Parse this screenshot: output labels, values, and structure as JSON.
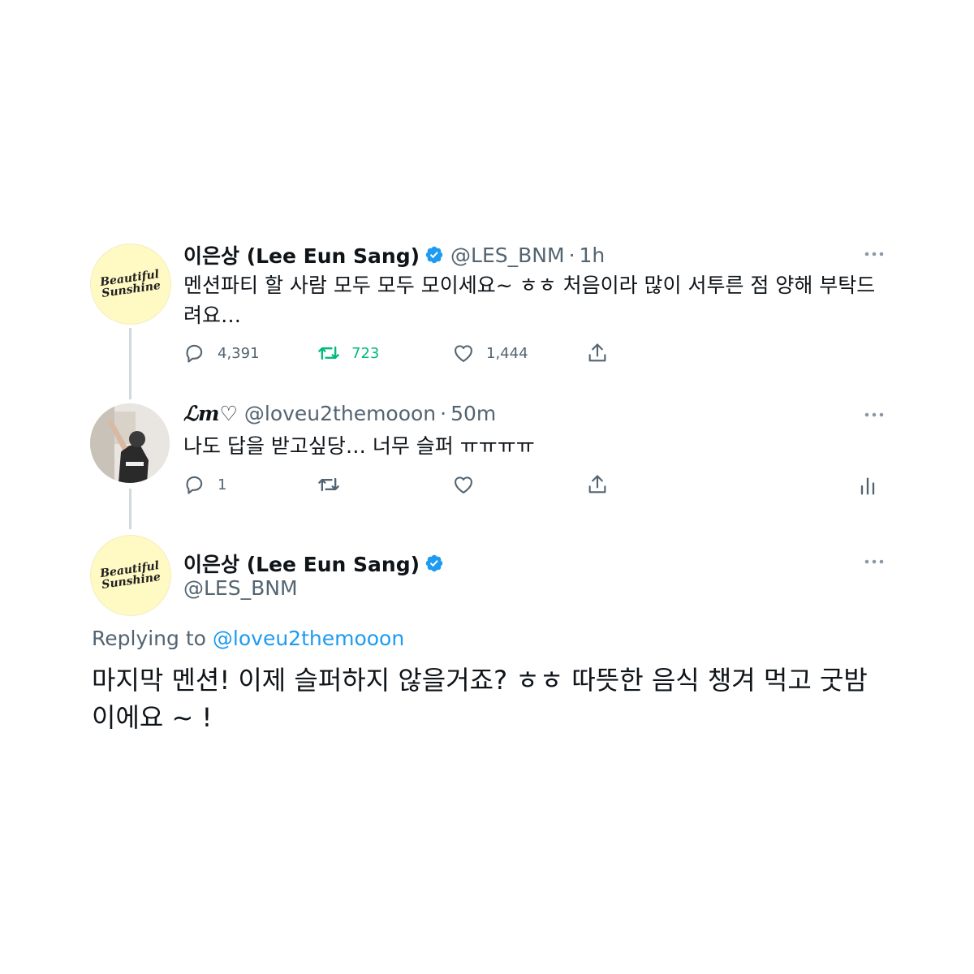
{
  "tweets": [
    {
      "avatar_text": [
        "Beautiful",
        "Sunshine"
      ],
      "name": "이은상 (Lee Eun Sang)",
      "handle": "@LES_BNM",
      "separator": "·",
      "time": "1h",
      "text": "멘션파티 할 사람 모두 모두 모이세요~ ㅎㅎ 처음이라 많이 서투른 점 양해 부탁드려요…",
      "replies": "4,391",
      "retweets": "723",
      "likes": "1,444"
    },
    {
      "name": "ℒm♡",
      "handle": "@loveu2themooon",
      "separator": "·",
      "time": "50m",
      "text": "나도 답을 받고싶당… 너무 슬퍼 ㅠㅠㅠㅠ",
      "replies": "1"
    }
  ],
  "main_tweet": {
    "avatar_text": [
      "Beautiful",
      "Sunshine"
    ],
    "name": "이은상 (Lee Eun Sang)",
    "handle": "@LES_BNM",
    "replying_prefix": "Replying to",
    "replying_handle": "@loveu2themooon",
    "text": "마지막 멘션! 이제 슬퍼하지 않을거죠? ㅎㅎ 따뜻한 음식 챙겨 먹고 굿밤이에요 ~ !"
  },
  "colors": {
    "accent": "#1d9bf0",
    "retweet_active": "#00ba7c",
    "muted": "#536471"
  }
}
